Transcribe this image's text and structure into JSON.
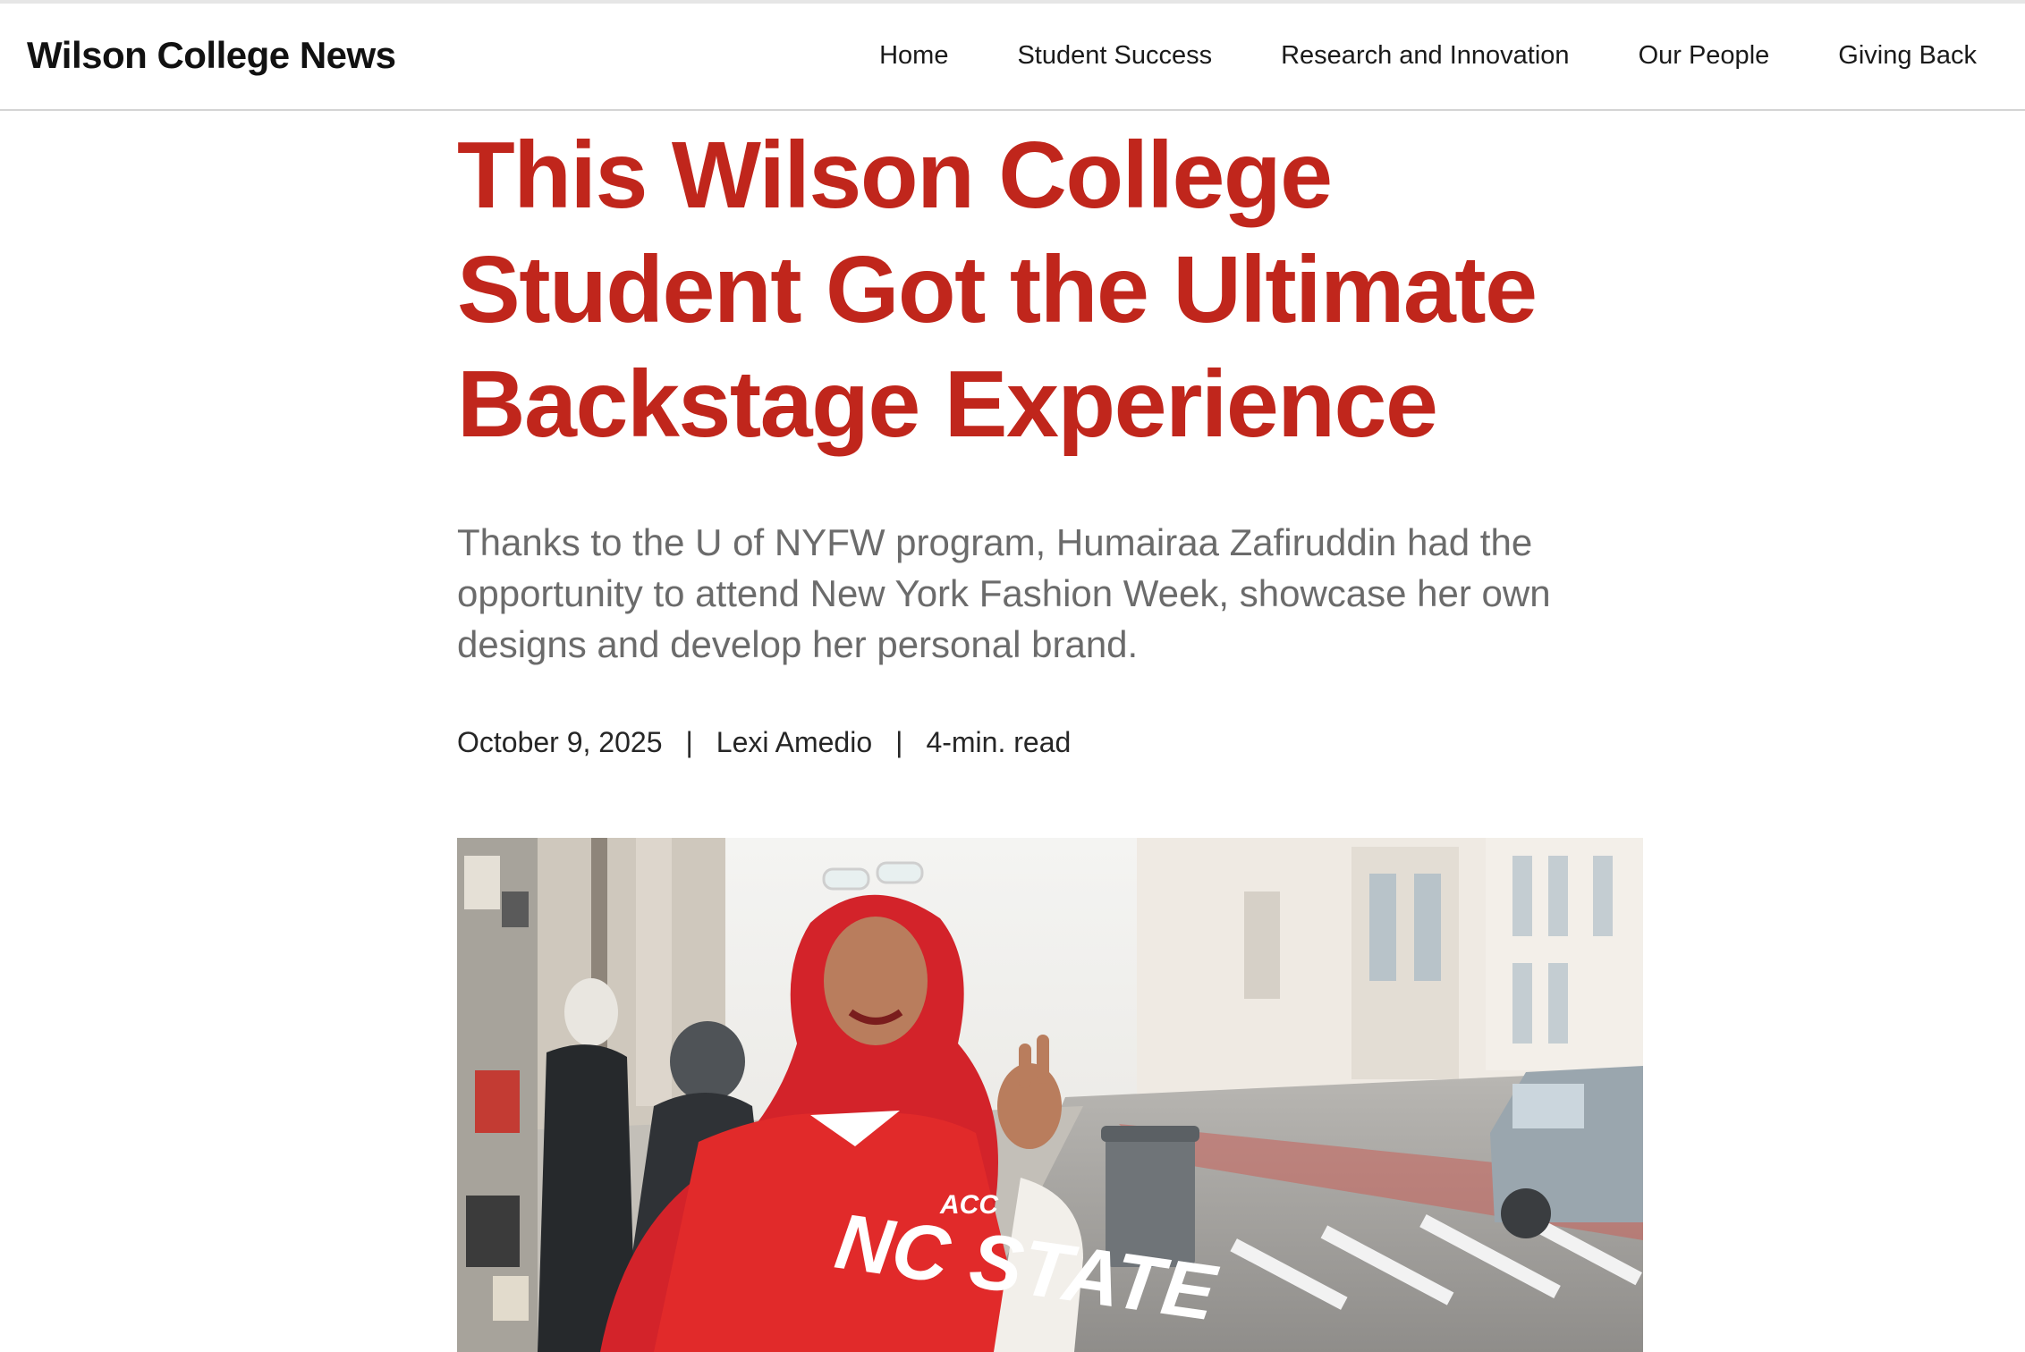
{
  "site": {
    "title": "Wilson College News"
  },
  "nav": {
    "items": [
      {
        "label": "Home"
      },
      {
        "label": "Student Success"
      },
      {
        "label": "Research and Innovation"
      },
      {
        "label": "Our People"
      },
      {
        "label": "Giving Back"
      }
    ]
  },
  "article": {
    "headline": "This Wilson College Student Got the Ultimate Backstage Experience",
    "dek": "Thanks to the U of NYFW program, Humairaa Zafiruddin had the opportunity to attend New York Fashion Week, showcase her own designs and develop her personal brand.",
    "meta": {
      "date": "October 9, 2025",
      "separator": "|",
      "author": "Lexi Amedio",
      "read_time": "4-min. read"
    },
    "hero_image": {
      "jersey_text": "NC STATE",
      "jersey_badge": "ACC"
    }
  },
  "colors": {
    "headline": "#c0261c",
    "dek": "#6b6b6b",
    "text": "#1a1a1a",
    "header_border": "#d4d4d4"
  }
}
